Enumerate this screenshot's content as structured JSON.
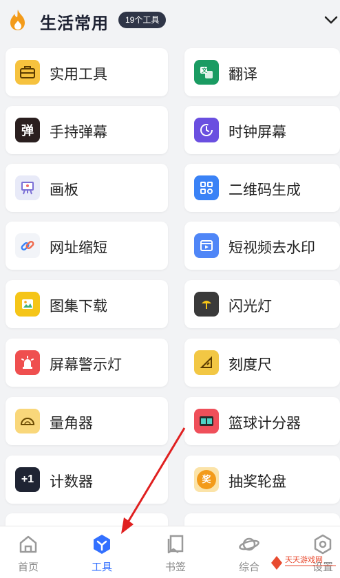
{
  "header": {
    "title": "生活常用",
    "badge": "19个工具"
  },
  "tools": [
    {
      "label": "实用工具",
      "icon": "toolbox-icon",
      "color": "#f6c23e",
      "glyph": ""
    },
    {
      "label": "翻译",
      "icon": "translate-icon",
      "color": "#1a9b62",
      "glyph": ""
    },
    {
      "label": "手持弹幕",
      "icon": "danmaku-icon",
      "color": "#2a1f1f",
      "glyph": "弹"
    },
    {
      "label": "时钟屏幕",
      "icon": "clock-icon",
      "color": "#6a4fe0",
      "glyph": ""
    },
    {
      "label": "画板",
      "icon": "easel-icon",
      "color": "#e8eaf8",
      "glyph": ""
    },
    {
      "label": "二维码生成",
      "icon": "qr-code-icon",
      "color": "#3a82f6",
      "glyph": ""
    },
    {
      "label": "网址缩短",
      "icon": "link-icon",
      "color": "#f2f4f8",
      "glyph": ""
    },
    {
      "label": "短视频去水印",
      "icon": "video-icon",
      "color": "#4f86f7",
      "glyph": ""
    },
    {
      "label": "图集下载",
      "icon": "gallery-icon",
      "color": "#f5c518",
      "glyph": ""
    },
    {
      "label": "闪光灯",
      "icon": "flashlight-icon",
      "color": "#3a3a3a",
      "glyph": ""
    },
    {
      "label": "屏幕警示灯",
      "icon": "alarm-light-icon",
      "color": "#ef4f4f",
      "glyph": ""
    },
    {
      "label": "刻度尺",
      "icon": "ruler-icon",
      "color": "#f2c744",
      "glyph": ""
    },
    {
      "label": "量角器",
      "icon": "protractor-icon",
      "color": "#f9d77a",
      "glyph": ""
    },
    {
      "label": "篮球计分器",
      "icon": "scoreboard-icon",
      "color": "#ef4f5a",
      "glyph": ""
    },
    {
      "label": "计数器",
      "icon": "counter-icon",
      "color": "#1f2433",
      "glyph": "+1"
    },
    {
      "label": "抽奖轮盘",
      "icon": "lottery-icon",
      "color": "#fbe3a8",
      "glyph": "奖"
    }
  ],
  "tabbar": {
    "items": [
      {
        "label": "首页",
        "icon": "home-icon"
      },
      {
        "label": "工具",
        "icon": "tools-icon"
      },
      {
        "label": "书签",
        "icon": "bookmark-icon"
      },
      {
        "label": "综合",
        "icon": "planet-icon"
      },
      {
        "label": "设置",
        "icon": "settings-icon"
      }
    ],
    "active_index": 1
  },
  "watermark": {
    "text": "天天游戏网"
  },
  "colors": {
    "accent": "#3370ff",
    "arrow": "#e02020"
  }
}
